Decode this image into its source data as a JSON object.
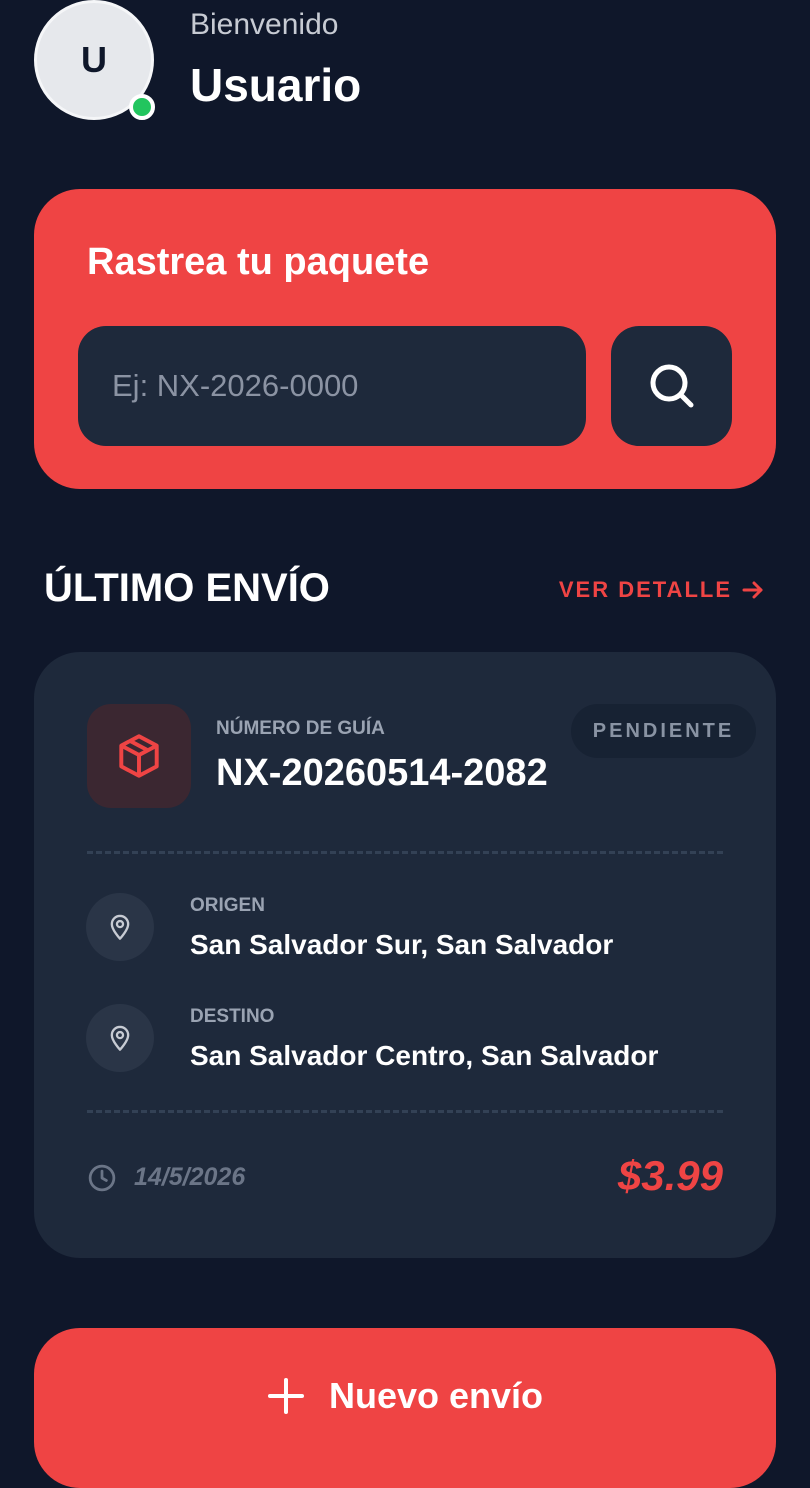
{
  "header": {
    "avatar_initial": "U",
    "greeting": "Bienvenido",
    "username": "Usuario"
  },
  "tracking": {
    "title": "Rastrea tu paquete",
    "input_value": "",
    "placeholder": "Ej: NX-2026-0000",
    "search_icon": "search-icon"
  },
  "latest": {
    "section_title": "ÚLTIMO ENVÍO",
    "detail_link": "VER DETALLE",
    "detail_icon": "arrow-right-icon"
  },
  "shipment": {
    "guide_label": "NÚMERO DE GUÍA",
    "guide_number": "NX-20260514-2082",
    "status": "PENDIENTE",
    "origin_label": "ORIGEN",
    "origin_value": "San Salvador Sur, San Salvador",
    "destination_label": "DESTINO",
    "destination_value": "San Salvador Centro, San Salvador",
    "date": "14/5/2026",
    "price": "$3.99"
  },
  "actions": {
    "new_shipment": "Nuevo envío"
  },
  "colors": {
    "background": "#0f172a",
    "accent": "#ef4444",
    "card": "#1e293b",
    "online": "#22c55e"
  }
}
